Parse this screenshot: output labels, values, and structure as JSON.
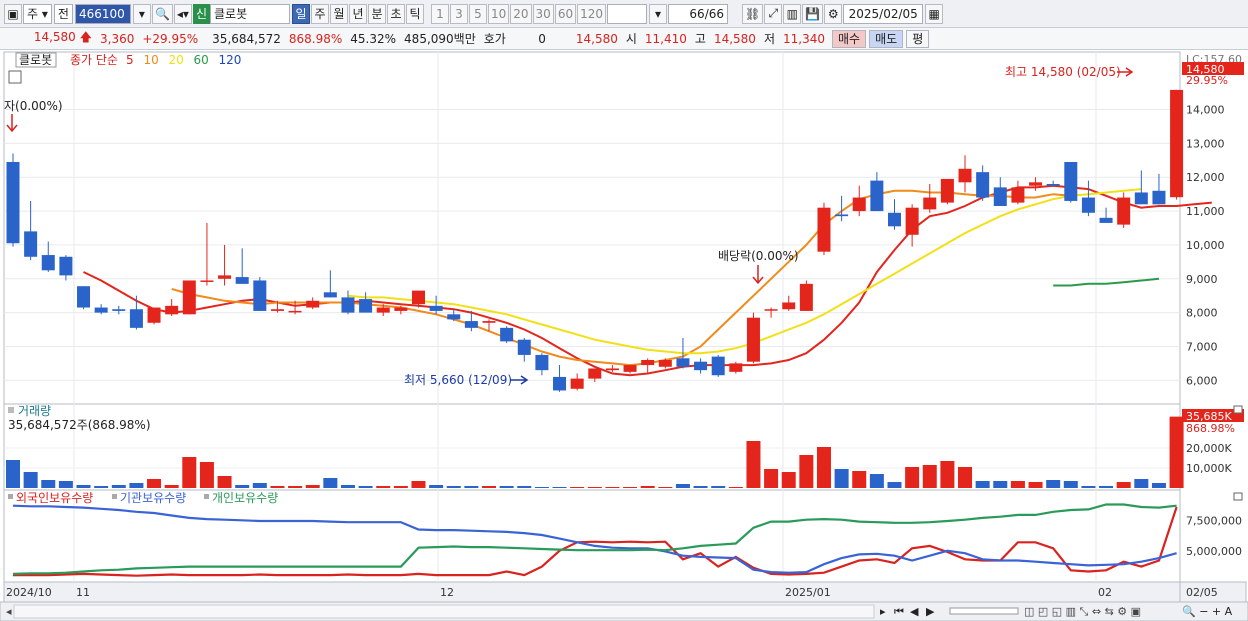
{
  "toolbar": {
    "market": "주",
    "period_sel": "전",
    "code": "466100",
    "badge": "신",
    "stock_name": "클로봇",
    "periods": [
      "일",
      "주",
      "월",
      "년",
      "분",
      "초",
      "틱"
    ],
    "active_period": "일",
    "intervals": [
      "1",
      "3",
      "5",
      "10",
      "20",
      "30",
      "60",
      "120"
    ],
    "count": "66/66",
    "date": "2025/02/05"
  },
  "quote": {
    "price": "14,580",
    "change": "3,360",
    "change_pct": "+29.95%",
    "volume": "35,684,572",
    "volume_ratio": "868.98%",
    "turnover": "45.32%",
    "amount": "485,090백만",
    "hoga_label": "호가",
    "hoga_value": "0",
    "hoga_price": "14,580",
    "open_label": "시",
    "open": "11,410",
    "high_label": "고",
    "high": "14,580",
    "low_label": "저",
    "low": "11,340",
    "buy_label": "매수",
    "sell_label": "매도",
    "eval_label": "평"
  },
  "legend": {
    "name": "클로봇",
    "prefix": "종가 단순",
    "ma": [
      {
        "label": "5",
        "color": "#d8231f"
      },
      {
        "label": "10",
        "color": "#f08a1a"
      },
      {
        "label": "20",
        "color": "#f2e016"
      },
      {
        "label": "60",
        "color": "#2a9a4a"
      },
      {
        "label": "120",
        "color": "#1c47c9"
      }
    ]
  },
  "annotations": {
    "left_marker": "자(0.00%)",
    "ex_div": "배당락(0.00%)",
    "low": "최저 5,660 (12/09)",
    "high": "최고 14,580 (02/05)",
    "top_clip": "LC:157.60",
    "price_tag": "14,580",
    "pct_tag": "29.95%"
  },
  "volume_panel": {
    "title": "거래량",
    "info": "35,684,572주(868.98%)",
    "tag_value": "35,685K",
    "tag_pct": "868.98%",
    "y_ticks": [
      "20,000K",
      "10,000K"
    ]
  },
  "holdings_panel": {
    "legend": [
      "외국인보유수량",
      "기관보유수량",
      "개인보유수량"
    ],
    "colors": [
      "#d8231f",
      "#3a63d6",
      "#2a9a5a"
    ],
    "y_ticks": [
      "7,500,000",
      "5,000,000"
    ]
  },
  "x_axis": [
    "2024/10",
    "11",
    "12",
    "2025/01",
    "02",
    "02/05"
  ],
  "chart_data": {
    "type": "candlestick",
    "price_ticks": [
      14000,
      13000,
      12000,
      11000,
      10000,
      9000,
      8000,
      7000,
      6000
    ],
    "ylim": [
      5300,
      15700
    ],
    "up_color": "#e3251c",
    "down_color": "#2a63c9",
    "candles": [
      [
        12450,
        12700,
        9950,
        10050
      ],
      [
        10400,
        11300,
        9550,
        9650
      ],
      [
        9700,
        10100,
        9200,
        9250
      ],
      [
        9650,
        9700,
        8950,
        9100
      ],
      [
        8780,
        8780,
        8100,
        8150
      ],
      [
        8150,
        8250,
        7950,
        8000
      ],
      [
        8100,
        8200,
        7950,
        8050
      ],
      [
        8100,
        8500,
        7500,
        7550
      ],
      [
        7700,
        8150,
        7650,
        8150
      ],
      [
        7950,
        8400,
        7900,
        8200
      ],
      [
        7950,
        8900,
        7950,
        8950
      ],
      [
        8950,
        10650,
        8800,
        8950
      ],
      [
        9000,
        10000,
        8800,
        9100
      ],
      [
        9050,
        9900,
        8850,
        8850
      ],
      [
        8950,
        9050,
        8050,
        8050
      ],
      [
        8050,
        8350,
        8000,
        8100
      ],
      [
        8050,
        8350,
        7950,
        8050
      ],
      [
        8150,
        8450,
        8100,
        8350
      ],
      [
        8600,
        9250,
        8450,
        8450
      ],
      [
        8450,
        8650,
        7950,
        8000
      ],
      [
        8400,
        8600,
        8000,
        8000
      ],
      [
        8000,
        8250,
        7900,
        8150
      ],
      [
        8050,
        8200,
        7950,
        8150
      ],
      [
        8250,
        8650,
        8150,
        8650
      ],
      [
        8200,
        8500,
        7950,
        8050
      ],
      [
        7950,
        8100,
        7750,
        7800
      ],
      [
        7750,
        8050,
        7450,
        7550
      ],
      [
        7700,
        7800,
        7450,
        7750
      ],
      [
        7550,
        7600,
        7100,
        7150
      ],
      [
        7200,
        7250,
        6550,
        6750
      ],
      [
        6750,
        6800,
        6150,
        6300
      ],
      [
        6100,
        6450,
        5660,
        5700
      ],
      [
        5750,
        6200,
        5700,
        6050
      ],
      [
        6050,
        6200,
        5950,
        6350
      ],
      [
        6300,
        6450,
        6250,
        6350
      ],
      [
        6250,
        6450,
        6200,
        6450
      ],
      [
        6450,
        6650,
        6200,
        6600
      ],
      [
        6400,
        6650,
        6350,
        6600
      ],
      [
        6650,
        7250,
        6350,
        6400
      ],
      [
        6550,
        6650,
        6200,
        6300
      ],
      [
        6700,
        6750,
        6100,
        6150
      ],
      [
        6250,
        6550,
        6200,
        6500
      ],
      [
        6550,
        8000,
        6500,
        7850
      ],
      [
        8100,
        8150,
        7850,
        8100
      ],
      [
        8100,
        8500,
        8050,
        8300
      ],
      [
        8050,
        8950,
        8050,
        8850
      ],
      [
        9800,
        11250,
        9700,
        11100
      ],
      [
        10900,
        11450,
        10700,
        10850
      ],
      [
        11000,
        11750,
        10850,
        11400
      ],
      [
        11900,
        12150,
        11000,
        11000
      ],
      [
        10950,
        11350,
        10450,
        10550
      ],
      [
        10300,
        11200,
        9950,
        11100
      ],
      [
        11050,
        11800,
        10950,
        11400
      ],
      [
        11250,
        11950,
        11200,
        11950
      ],
      [
        11850,
        12650,
        11550,
        12250
      ],
      [
        12150,
        12350,
        11300,
        11400
      ],
      [
        11700,
        12000,
        11150,
        11150
      ],
      [
        11250,
        11900,
        11200,
        11700
      ],
      [
        11750,
        12000,
        11600,
        11850
      ],
      [
        11800,
        11900,
        11750,
        11750
      ],
      [
        12450,
        12450,
        11250,
        11300
      ],
      [
        11400,
        11900,
        10850,
        10950
      ],
      [
        10800,
        11100,
        10750,
        10650
      ],
      [
        10600,
        11550,
        10500,
        11400
      ],
      [
        11550,
        12200,
        11250,
        11200
      ],
      [
        11600,
        12100,
        11200,
        11200
      ],
      [
        11410,
        14580,
        11340,
        14580
      ]
    ],
    "ma": {
      "ma5": {
        "start": 4,
        "values": [
          9200,
          8950,
          8650,
          8350,
          8100,
          8000,
          8050,
          8150,
          8250,
          8350,
          8400,
          8300,
          8200,
          8250,
          8300,
          8300,
          8350,
          8300,
          8250,
          8200,
          8150,
          8100,
          8000,
          7850,
          7700,
          7500,
          7250,
          6950,
          6650,
          6400,
          6200,
          6150,
          6200,
          6300,
          6400,
          6450,
          6450,
          6450,
          6450,
          6500,
          6600,
          6800,
          7200,
          7700,
          8300,
          9200,
          9850,
          10450,
          10850,
          10950,
          11150,
          11400,
          11550,
          11700,
          11700,
          11750,
          11700,
          11650,
          11450,
          11250,
          11100,
          11150,
          11150,
          11200,
          11250
        ]
      },
      "ma10": {
        "start": 9,
        "values": [
          8700,
          8550,
          8450,
          8350,
          8300,
          8250,
          8300,
          8300,
          8300,
          8300,
          8300,
          8250,
          8200,
          8150,
          8050,
          7950,
          7800,
          7650,
          7450,
          7250,
          7050,
          6850,
          6700,
          6600,
          6550,
          6500,
          6450,
          6500,
          6600,
          6700,
          7000,
          7500,
          8000,
          8500,
          9000,
          9500,
          10000,
          10600,
          11000,
          11350,
          11500,
          11600,
          11600,
          11550,
          11550,
          11500,
          11450,
          11450,
          11400,
          11400,
          11500,
          11450
        ]
      },
      "ma20": {
        "start": 19,
        "values": [
          8500,
          8450,
          8450,
          8400,
          8350,
          8300,
          8250,
          8150,
          8050,
          7950,
          7800,
          7650,
          7500,
          7350,
          7200,
          7100,
          7000,
          6900,
          6850,
          6800,
          6800,
          6850,
          6950,
          7100,
          7300,
          7500,
          7700,
          7950,
          8250,
          8550,
          8850,
          9150,
          9450,
          9750,
          10050,
          10350,
          10600,
          10850,
          11050,
          11200,
          11350,
          11450,
          11500,
          11550,
          11600,
          11650
        ]
      },
      "ma60": {
        "start": 59,
        "values": [
          8800,
          8800,
          8850,
          8850,
          8900,
          8950,
          9000
        ]
      }
    },
    "volume": {
      "ylim": [
        0,
        38000
      ],
      "values": [
        14000,
        8000,
        4000,
        3500,
        1500,
        1000,
        1500,
        2500,
        4500,
        1500,
        15500,
        13000,
        6000,
        1500,
        2500,
        1000,
        1000,
        1500,
        5000,
        1500,
        1000,
        1000,
        1000,
        3500,
        1500,
        1000,
        1000,
        1000,
        1000,
        1000,
        500,
        500,
        500,
        500,
        500,
        500,
        1000,
        500,
        2000,
        1000,
        1000,
        500,
        23500,
        9500,
        8000,
        16500,
        20500,
        9500,
        8500,
        7000,
        3000,
        10500,
        11500,
        13500,
        10500,
        3500,
        3500,
        3500,
        3000,
        4000,
        3500,
        1000,
        1000,
        3000,
        4500,
        2500,
        35685
      ]
    },
    "holdings": {
      "ylim": [
        2600000,
        9500000
      ],
      "foreign": [
        3000000,
        3000000,
        3000000,
        3050000,
        3100000,
        3050000,
        3000000,
        2950000,
        3000000,
        3050000,
        3000000,
        3000000,
        3000000,
        3000000,
        3050000,
        3000000,
        3000000,
        3000000,
        3000000,
        3050000,
        3000000,
        3000000,
        3000000,
        3100000,
        3000000,
        3000000,
        3000000,
        3000000,
        3300000,
        3000000,
        3700000,
        5000000,
        5700000,
        5750000,
        5700000,
        5750000,
        5700000,
        5750000,
        4300000,
        4800000,
        3700000,
        4500000,
        3600000,
        3100000,
        3050000,
        3100000,
        3200000,
        3700000,
        4200000,
        4300000,
        4000000,
        5200000,
        5400000,
        4900000,
        4300000,
        4200000,
        4200000,
        5700000,
        5700000,
        5200000,
        3400000,
        3300000,
        3400000,
        4100000,
        3700000,
        4200000,
        8600000
      ],
      "institution": [
        8700000,
        8650000,
        8650000,
        8600000,
        8550000,
        8450000,
        8350000,
        8200000,
        8100000,
        7900000,
        7700000,
        7600000,
        7550000,
        7500000,
        7450000,
        7450000,
        7450000,
        7450000,
        7400000,
        7350000,
        7350000,
        7350000,
        7350000,
        6750000,
        6700000,
        6700000,
        6650000,
        6600000,
        6550000,
        6450000,
        6300000,
        6000000,
        5700000,
        5400000,
        5250000,
        5200000,
        5200000,
        4950000,
        4600000,
        4500000,
        4450000,
        4400000,
        3450000,
        3250000,
        3200000,
        3250000,
        3900000,
        4400000,
        4700000,
        4750000,
        4600000,
        4200000,
        4600000,
        5000000,
        4800000,
        4300000,
        4200000,
        4200000,
        4100000,
        4000000,
        3900000,
        3800000,
        3850000,
        3900000,
        4100000,
        4400000,
        4800000
      ],
      "retail": [
        3100000,
        3150000,
        3150000,
        3200000,
        3300000,
        3400000,
        3450000,
        3550000,
        3600000,
        3650000,
        3700000,
        3700000,
        3700000,
        3700000,
        3700000,
        3700000,
        3700000,
        3700000,
        3700000,
        3700000,
        3700000,
        3700000,
        3700000,
        5250000,
        5300000,
        5350000,
        5300000,
        5300000,
        5250000,
        5200000,
        5150000,
        5100000,
        5050000,
        5050000,
        5050000,
        5050000,
        5100000,
        5050000,
        5200000,
        5400000,
        5500000,
        5600000,
        6900000,
        7400000,
        7400000,
        7550000,
        7600000,
        7550000,
        7400000,
        7350000,
        7300000,
        7300000,
        7350000,
        7450000,
        7550000,
        7700000,
        7800000,
        7950000,
        7950000,
        8200000,
        8350000,
        8400000,
        8800000,
        8800000,
        8600000,
        8550000,
        8700000
      ]
    }
  }
}
